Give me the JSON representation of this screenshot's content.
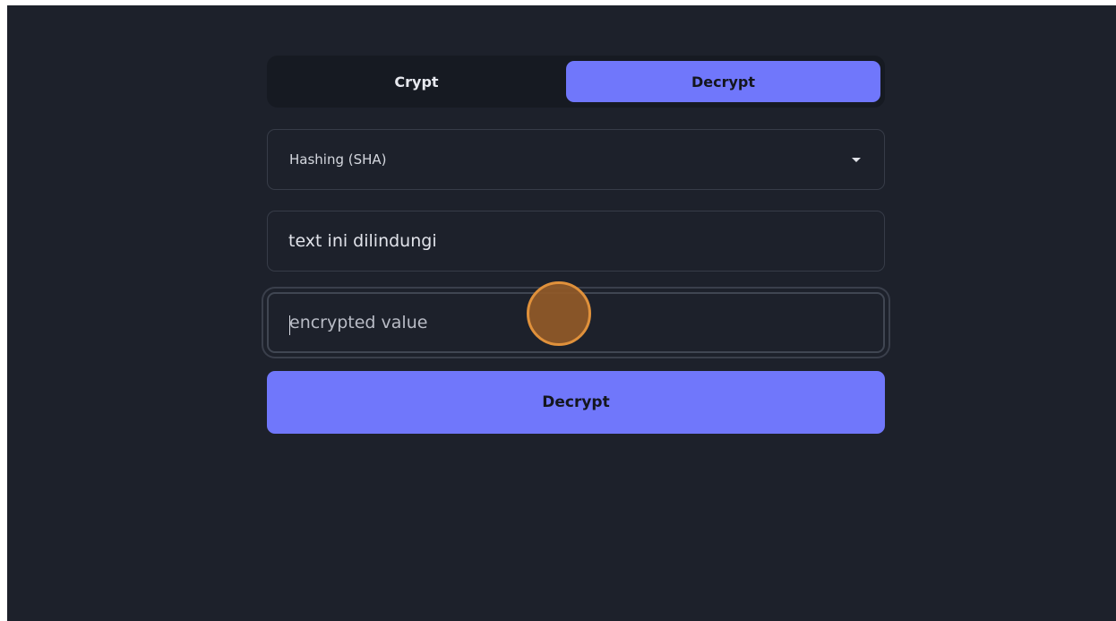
{
  "tabs": [
    {
      "label": "Crypt",
      "active": false
    },
    {
      "label": "Decrypt",
      "active": true
    }
  ],
  "algorithm_select": {
    "selected": "Hashing (SHA)"
  },
  "plain_text_input": {
    "value": "text ini dilindungi"
  },
  "encrypted_input": {
    "placeholder": "encrypted value",
    "value": ""
  },
  "action_button": {
    "label": "Decrypt"
  },
  "colors": {
    "background": "#1d212b",
    "accent": "#7077fb",
    "tab_bar": "#161a22",
    "click_indicator": "#e0913b"
  },
  "icons": {
    "select_caret": "chevron-down-icon"
  }
}
